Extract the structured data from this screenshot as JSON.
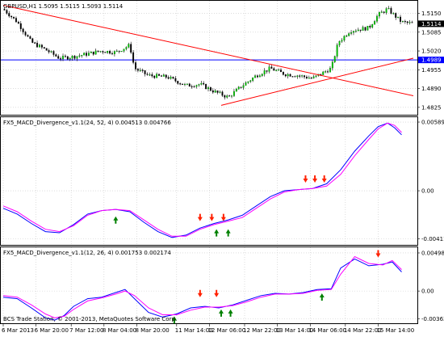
{
  "chart_data": [
    {
      "type": "line",
      "chart_kind": "candlestick",
      "title": "GBPUSD,H1  1.5095 1.5115 1.5093 1.5114",
      "ylim": [
        1.4805,
        1.5185
      ],
      "y_ticks": [
        {
          "value": 1.515,
          "label": "1.5150"
        },
        {
          "value": 1.5085,
          "label": "1.5085"
        },
        {
          "value": 1.502,
          "label": "1.5020"
        },
        {
          "value": 1.4955,
          "label": "1.4955"
        },
        {
          "value": 1.489,
          "label": "1.4890"
        },
        {
          "value": 1.4825,
          "label": "1.4825"
        }
      ],
      "current_price": {
        "value": 1.5114,
        "label": "1.5114"
      },
      "horizontal_line": {
        "value": 1.4989,
        "label": "1.4989",
        "color": "#0000ff"
      },
      "trendlines": [
        {
          "color": "#ff0000",
          "from_bar": 0,
          "from_price": 1.5178,
          "to_bar": 175,
          "to_price": 1.4865
        },
        {
          "color": "#ff0000",
          "from_bar": 93,
          "from_price": 1.4832,
          "to_bar": 175,
          "to_price": 1.4995
        }
      ],
      "bar_count": 175,
      "close_path": [
        [
          0,
          1.5165
        ],
        [
          6,
          1.512
        ],
        [
          12,
          1.505
        ],
        [
          18,
          1.5025
        ],
        [
          24,
          1.4995
        ],
        [
          30,
          1.5
        ],
        [
          36,
          1.501
        ],
        [
          42,
          1.502
        ],
        [
          48,
          1.5015
        ],
        [
          54,
          1.504
        ],
        [
          56,
          1.496
        ],
        [
          62,
          1.4935
        ],
        [
          70,
          1.493
        ],
        [
          78,
          1.49
        ],
        [
          84,
          1.4905
        ],
        [
          90,
          1.488
        ],
        [
          96,
          1.486
        ],
        [
          102,
          1.49
        ],
        [
          108,
          1.4935
        ],
        [
          114,
          1.496
        ],
        [
          120,
          1.494
        ],
        [
          126,
          1.4935
        ],
        [
          132,
          1.4925
        ],
        [
          140,
          1.496
        ],
        [
          143,
          1.505
        ],
        [
          148,
          1.509
        ],
        [
          156,
          1.51
        ],
        [
          160,
          1.5145
        ],
        [
          164,
          1.5165
        ],
        [
          170,
          1.512
        ],
        [
          175,
          1.5114
        ]
      ],
      "colors": {
        "bull": "#00c800",
        "bear": "#000000",
        "grid": "#c0c0c0"
      }
    },
    {
      "type": "line",
      "title": "FX5_MACD_Divergence_v1.1(24, 52, 4) 0.004513 0.004766",
      "ylim": [
        -0.0045,
        0.0061
      ],
      "y_ticks": [
        {
          "value": 0.00589,
          "label": "0.00589"
        },
        {
          "value": 0.0,
          "label": "0.00"
        },
        {
          "value": -0.00411,
          "label": "-0.00411"
        }
      ],
      "series": [
        {
          "color": "#0000ff",
          "points": [
            [
              0,
              -0.0015
            ],
            [
              6,
              -0.002
            ],
            [
              12,
              -0.0028
            ],
            [
              18,
              -0.0035
            ],
            [
              24,
              -0.0036
            ],
            [
              30,
              -0.0029
            ],
            [
              36,
              -0.002
            ],
            [
              42,
              -0.0017
            ],
            [
              48,
              -0.0016
            ],
            [
              54,
              -0.0018
            ],
            [
              60,
              -0.0027
            ],
            [
              66,
              -0.0035
            ],
            [
              72,
              -0.004
            ],
            [
              78,
              -0.0038
            ],
            [
              84,
              -0.0032
            ],
            [
              90,
              -0.0028
            ],
            [
              96,
              -0.0025
            ],
            [
              102,
              -0.0021
            ],
            [
              108,
              -0.0013
            ],
            [
              114,
              -0.0005
            ],
            [
              120,
              0.0
            ],
            [
              126,
              0.0001
            ],
            [
              132,
              0.0002
            ],
            [
              138,
              0.0006
            ],
            [
              144,
              0.0018
            ],
            [
              150,
              0.0034
            ],
            [
              156,
              0.0047
            ],
            [
              160,
              0.0055
            ],
            [
              164,
              0.0058
            ],
            [
              167,
              0.0054
            ],
            [
              170,
              0.0048
            ]
          ]
        },
        {
          "color": "#ff00ff",
          "points": [
            [
              0,
              -0.0013
            ],
            [
              6,
              -0.0018
            ],
            [
              12,
              -0.0026
            ],
            [
              18,
              -0.0033
            ],
            [
              24,
              -0.0035
            ],
            [
              30,
              -0.003
            ],
            [
              36,
              -0.0021
            ],
            [
              42,
              -0.0017
            ],
            [
              48,
              -0.0016
            ],
            [
              54,
              -0.0017
            ],
            [
              60,
              -0.0025
            ],
            [
              66,
              -0.0033
            ],
            [
              72,
              -0.0039
            ],
            [
              78,
              -0.0039
            ],
            [
              84,
              -0.0033
            ],
            [
              90,
              -0.0029
            ],
            [
              96,
              -0.0026
            ],
            [
              102,
              -0.0023
            ],
            [
              108,
              -0.0015
            ],
            [
              114,
              -0.0007
            ],
            [
              120,
              -0.0001
            ],
            [
              126,
              0.0001
            ],
            [
              132,
              0.0002
            ],
            [
              138,
              0.0004
            ],
            [
              144,
              0.0014
            ],
            [
              150,
              0.003
            ],
            [
              156,
              0.0044
            ],
            [
              160,
              0.0053
            ],
            [
              164,
              0.0058
            ],
            [
              167,
              0.0056
            ],
            [
              170,
              0.005
            ]
          ]
        }
      ],
      "down_arrows": [
        [
          84,
          -0.0026
        ],
        [
          89,
          -0.0026
        ],
        [
          94,
          -0.0026
        ],
        [
          129,
          0.0007
        ],
        [
          133,
          0.0007
        ],
        [
          137,
          0.0007
        ]
      ],
      "up_arrows": [
        [
          48,
          -0.0022
        ],
        [
          91,
          -0.0033
        ],
        [
          96,
          -0.0033
        ]
      ],
      "arrow_colors": {
        "down": "#ff2000",
        "up": "#008000"
      }
    },
    {
      "type": "line",
      "title": "FX5_MACD_Divergence_v1.1(12, 26, 4) 0.001753 0.002174",
      "ylim": [
        -0.004,
        0.0054
      ],
      "y_ticks": [
        {
          "value": 0.00498,
          "label": "0.00498"
        },
        {
          "value": 0.0,
          "label": "0.00"
        },
        {
          "value": -0.00363,
          "label": "-0.00363"
        }
      ],
      "series": [
        {
          "color": "#0000ff",
          "points": [
            [
              0,
              -0.0008
            ],
            [
              6,
              -0.001
            ],
            [
              12,
              -0.0022
            ],
            [
              18,
              -0.0035
            ],
            [
              22,
              -0.0038
            ],
            [
              26,
              -0.0032
            ],
            [
              30,
              -0.002
            ],
            [
              36,
              -0.001
            ],
            [
              42,
              -0.0008
            ],
            [
              48,
              -0.0002
            ],
            [
              52,
              0.0002
            ],
            [
              56,
              -0.001
            ],
            [
              62,
              -0.0028
            ],
            [
              68,
              -0.0034
            ],
            [
              74,
              -0.003
            ],
            [
              80,
              -0.0022
            ],
            [
              86,
              -0.002
            ],
            [
              92,
              -0.0022
            ],
            [
              98,
              -0.0018
            ],
            [
              104,
              -0.0012
            ],
            [
              110,
              -0.0006
            ],
            [
              116,
              -0.0003
            ],
            [
              122,
              -0.0004
            ],
            [
              128,
              -0.0002
            ],
            [
              134,
              0.0002
            ],
            [
              140,
              0.0003
            ],
            [
              144,
              0.003
            ],
            [
              150,
              0.0042
            ],
            [
              156,
              0.0033
            ],
            [
              162,
              0.0035
            ],
            [
              166,
              0.0038
            ],
            [
              170,
              0.0025
            ]
          ]
        },
        {
          "color": "#ff00ff",
          "points": [
            [
              0,
              -0.0006
            ],
            [
              6,
              -0.0008
            ],
            [
              12,
              -0.0018
            ],
            [
              18,
              -0.003
            ],
            [
              22,
              -0.0035
            ],
            [
              26,
              -0.0033
            ],
            [
              30,
              -0.0024
            ],
            [
              36,
              -0.0013
            ],
            [
              42,
              -0.0009
            ],
            [
              48,
              -0.0004
            ],
            [
              52,
              0.0
            ],
            [
              56,
              -0.0006
            ],
            [
              62,
              -0.0022
            ],
            [
              68,
              -0.0031
            ],
            [
              74,
              -0.0031
            ],
            [
              80,
              -0.0025
            ],
            [
              86,
              -0.0021
            ],
            [
              92,
              -0.0021
            ],
            [
              98,
              -0.0019
            ],
            [
              104,
              -0.0014
            ],
            [
              110,
              -0.0008
            ],
            [
              116,
              -0.0004
            ],
            [
              122,
              -0.0004
            ],
            [
              128,
              -0.0003
            ],
            [
              134,
              0.0001
            ],
            [
              140,
              0.0002
            ],
            [
              144,
              0.0022
            ],
            [
              150,
              0.0045
            ],
            [
              156,
              0.0036
            ],
            [
              162,
              0.0034
            ],
            [
              166,
              0.004
            ],
            [
              170,
              0.0028
            ]
          ]
        }
      ],
      "down_arrows": [
        [
          84,
          -0.0008
        ],
        [
          91,
          -0.0008
        ],
        [
          160,
          0.0044
        ]
      ],
      "up_arrows": [
        [
          73,
          -0.0033
        ],
        [
          93,
          -0.0024
        ],
        [
          97,
          -0.0024
        ],
        [
          136,
          -0.0003
        ]
      ],
      "arrow_colors": {
        "down": "#ff2000",
        "up": "#008000"
      }
    }
  ],
  "x_labels": [
    {
      "bar": 0,
      "label": "6 Mar 2013"
    },
    {
      "bar": 14,
      "label": "6 Mar 20:00"
    },
    {
      "bar": 29,
      "label": "7 Mar 12:00"
    },
    {
      "bar": 43,
      "label": "8 Mar 04:00"
    },
    {
      "bar": 57,
      "label": "8 Mar 20:00"
    },
    {
      "bar": 74,
      "label": "11 Mar 14:00"
    },
    {
      "bar": 88,
      "label": "12 Mar 06:00"
    },
    {
      "bar": 103,
      "label": "12 Mar 22:00"
    },
    {
      "bar": 117,
      "label": "13 Mar 14:00"
    },
    {
      "bar": 131,
      "label": "14 Mar 06:00"
    },
    {
      "bar": 146,
      "label": "14 Mar 22:00"
    },
    {
      "bar": 160,
      "label": "15 Mar 14:00"
    }
  ],
  "copyright": "BCS Trade Station, © 2001-2013, MetaQuotes Software Corp."
}
